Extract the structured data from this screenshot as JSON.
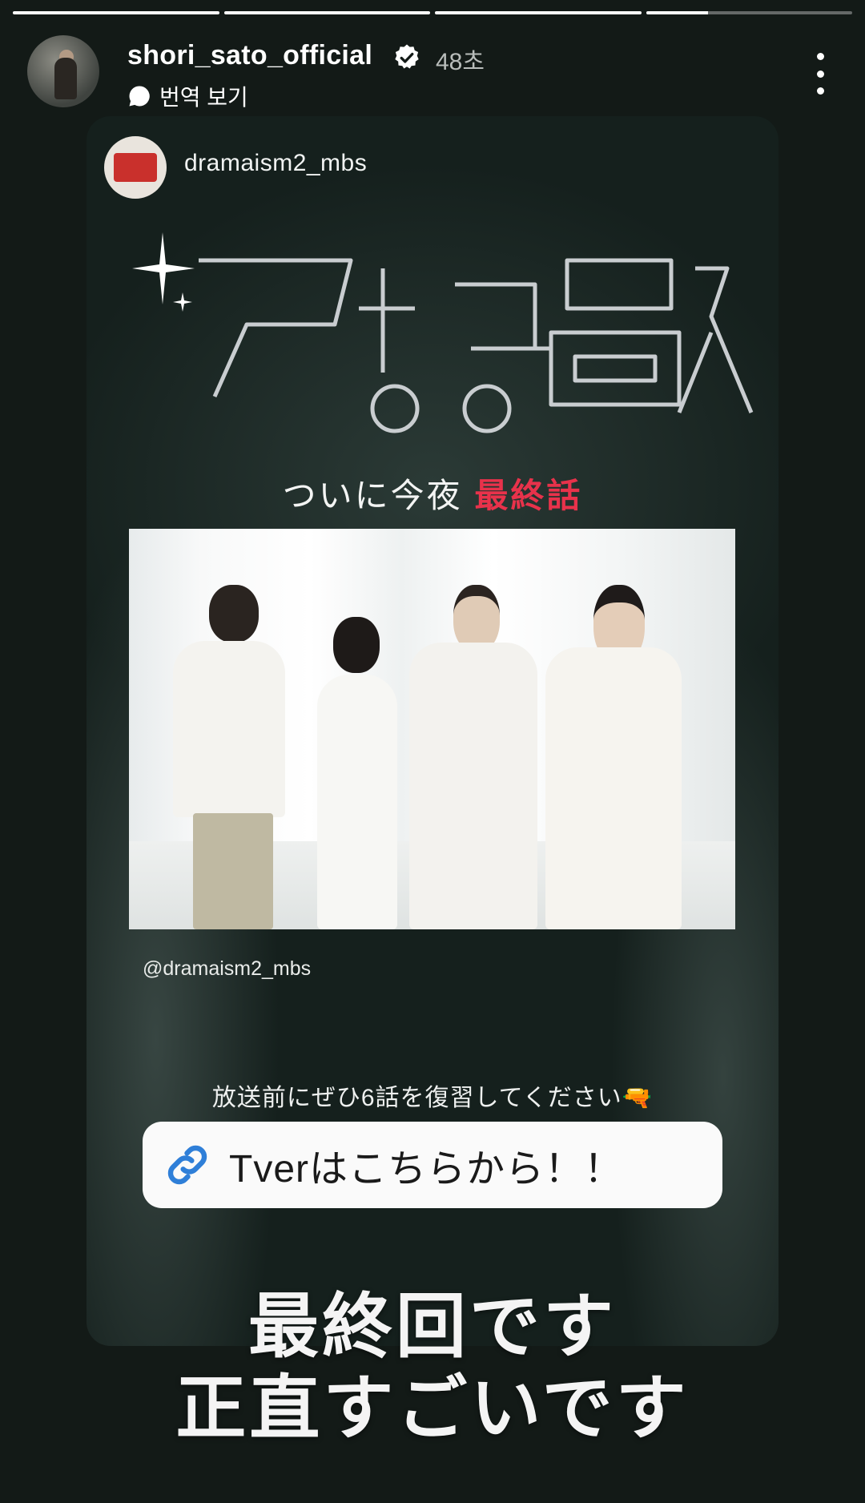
{
  "progress": [
    1,
    1,
    1,
    0.3
  ],
  "header": {
    "username": "shori_sato_official",
    "time": "48초",
    "translate_label": "번역 보기"
  },
  "card": {
    "source_account": "dramaism2_mbs",
    "title_logo": "アポロの歌",
    "tagline_prefix": "ついに今夜",
    "tagline_highlight": "最終話",
    "handle": "@dramaism2_mbs",
    "caption": "放送前にぜひ6話を復習してください🔫",
    "link_label": "Tverはこちらから！！"
  },
  "overlay": {
    "line1": "最終回です",
    "line2": "正直すごいです"
  },
  "colors": {
    "accent_red": "#e8324b",
    "link_blue": "#2f7fd8",
    "verified_blue": "#ffffff"
  }
}
